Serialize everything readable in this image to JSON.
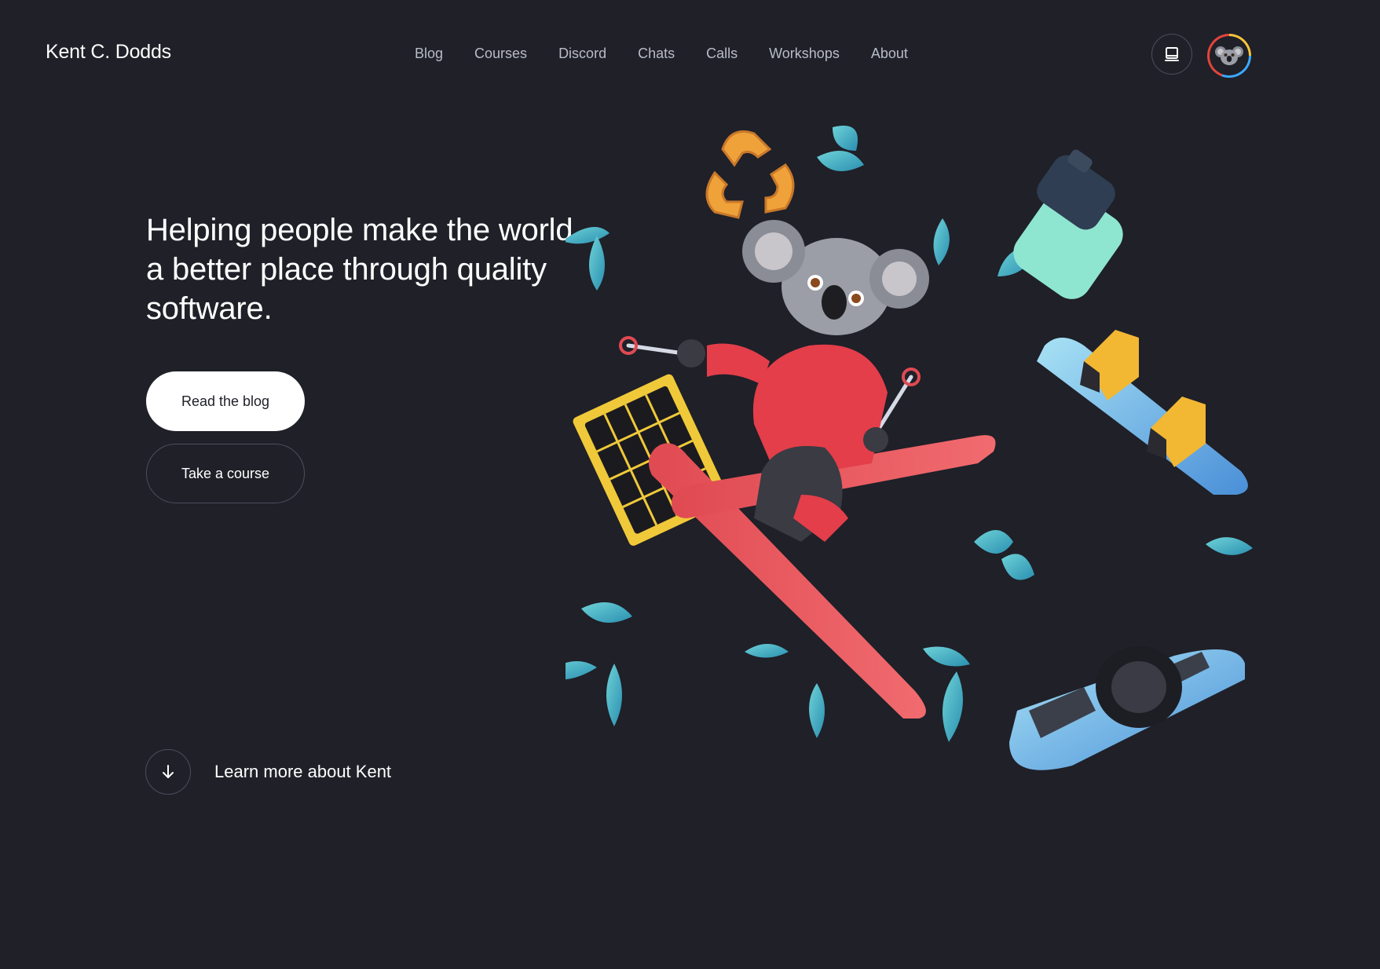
{
  "header": {
    "brand": "Kent C. Dodds",
    "nav": [
      "Blog",
      "Courses",
      "Discord",
      "Chats",
      "Calls",
      "Workshops",
      "About"
    ],
    "theme_toggle_icon": "laptop-icon",
    "avatar_icon": "koala-avatar-icon"
  },
  "hero": {
    "title": "Helping people make the world a better place through quality software.",
    "primary_button": "Read the blog",
    "secondary_button": "Take a course",
    "learn_more": "Learn more about Kent",
    "learn_more_icon": "arrow-down-icon",
    "illustration": "koala-skiing-illustration"
  },
  "colors": {
    "background": "#1f2028",
    "text": "#ffffff",
    "nav_text": "#b7bcc8",
    "border": "#4b4f5c"
  }
}
